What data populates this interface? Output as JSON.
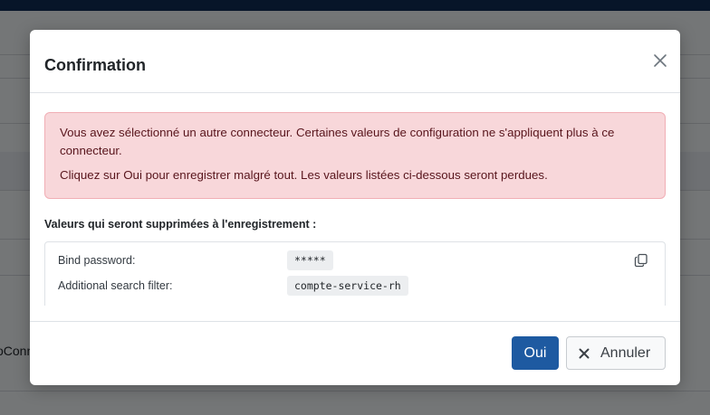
{
  "background": {
    "partial_text": "oConn"
  },
  "modal": {
    "title": "Confirmation",
    "close_icon": "close-icon",
    "alert": {
      "line1": "Vous avez sélectionné un autre connecteur. Certaines valeurs de configuration ne s'appliquent plus à ce connecteur.",
      "line2": "Cliquez sur Oui pour enregistrer malgré tout. Les valeurs listées ci-dessous seront perdues."
    },
    "section_label": "Valeurs qui seront supprimées à l'enregistrement :",
    "values": [
      {
        "key": "Bind password:",
        "value": "*****"
      },
      {
        "key": "Additional search filter:",
        "value": "compte-service-rh"
      }
    ],
    "copy_icon": "copy-icon",
    "buttons": {
      "confirm_label": "Oui",
      "cancel_label": "Annuler"
    }
  },
  "colors": {
    "primary": "#1e5aa1",
    "alert_bg": "#f8d7da",
    "alert_text": "#58151c",
    "topbar": "#0e2a52"
  }
}
